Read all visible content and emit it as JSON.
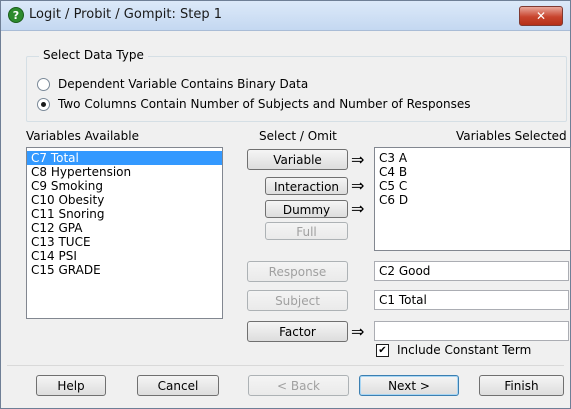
{
  "window": {
    "title": "Logit / Probit / Gompit: Step 1",
    "close_glyph": "✕"
  },
  "data_type": {
    "legend": "Select Data Type",
    "options": [
      {
        "label": "Dependent Variable Contains Binary Data",
        "checked": false
      },
      {
        "label": "Two Columns Contain Number of Subjects and Number of Responses",
        "checked": true
      }
    ]
  },
  "available": {
    "label": "Variables Available",
    "items": [
      "C7 Total",
      "C8 Hypertension",
      "C9 Smoking",
      "C10 Obesity",
      "C11 Snoring",
      "C12 GPA",
      "C13 TUCE",
      "C14 PSI",
      "C15 GRADE"
    ],
    "selected_index": 0
  },
  "select_omit": {
    "label": "Select / Omit",
    "variable_label": "Variable",
    "interaction_label": "Interaction",
    "dummy_label": "Dummy",
    "full_label": "Full",
    "response_label": "Response",
    "subject_label": "Subject",
    "factor_label": "Factor",
    "arrow_glyph": "⇒"
  },
  "selected": {
    "label": "Variables Selected",
    "items": [
      "C3 A",
      "C4 B",
      "C5 C",
      "C6 D"
    ]
  },
  "fields": {
    "response_value": "C2 Good",
    "subject_value": "C1 Total",
    "factor_value": ""
  },
  "constant_term": {
    "label": "Include Constant Term",
    "checked": true,
    "check_glyph": "✔"
  },
  "footer": {
    "help": "Help",
    "cancel": "Cancel",
    "back": "< Back",
    "next": "Next >",
    "finish": "Finish"
  },
  "colors": {
    "selection": "#3399ff",
    "title_icon": "#2e8b2e"
  }
}
